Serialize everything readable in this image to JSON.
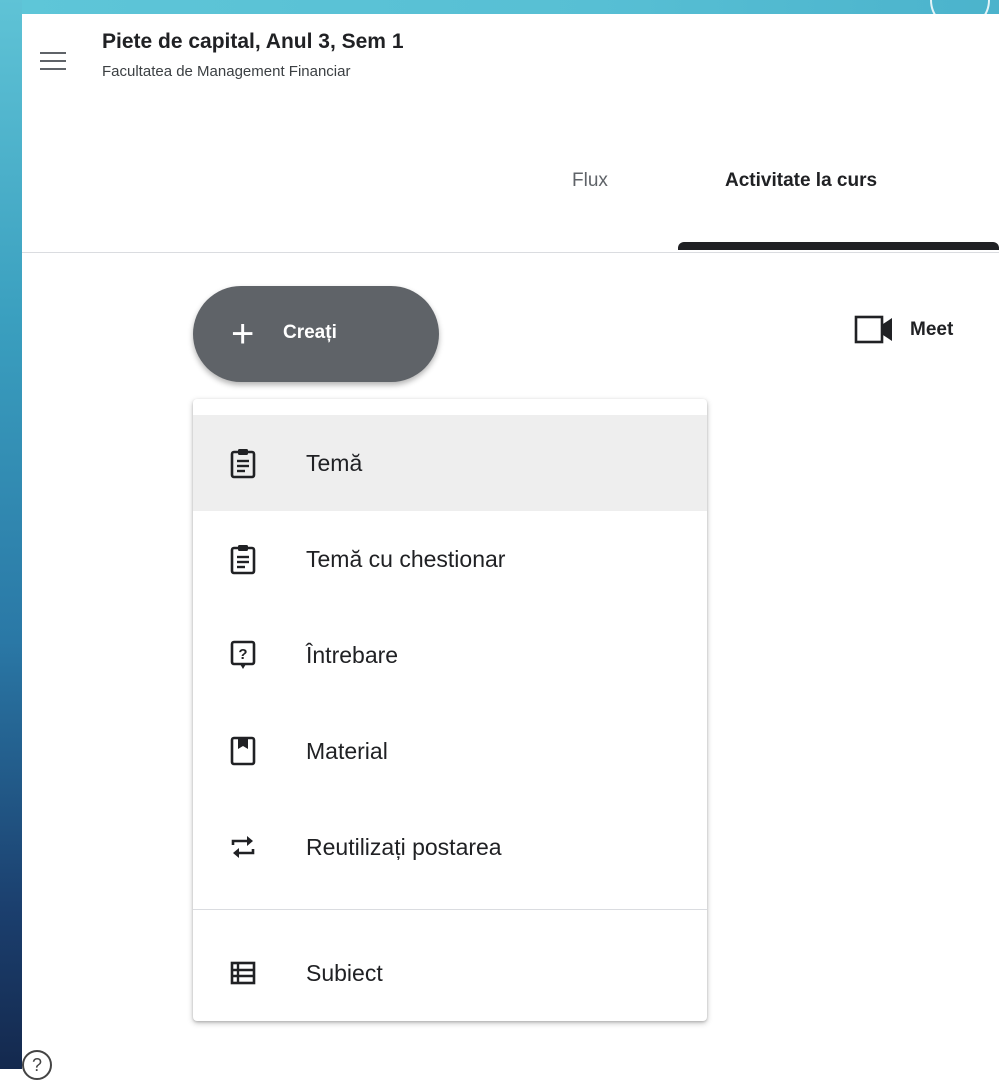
{
  "course": {
    "title": "Piete de capital, Anul 3, Sem 1",
    "subtitle": "Facultatea de Management Financiar"
  },
  "tabs": [
    {
      "label": "Flux",
      "selected": false
    },
    {
      "label": "Activitate la curs",
      "selected": true
    }
  ],
  "create_button": {
    "icon": "plus-icon",
    "label": "Creați"
  },
  "meet_button": {
    "icon": "video-camera-icon",
    "label": "Meet"
  },
  "create_menu": {
    "items": [
      {
        "label": "Temă",
        "icon": "assignment-icon",
        "highlighted": true
      },
      {
        "label": "Temă cu chestionar",
        "icon": "quiz-assignment-icon",
        "highlighted": false
      },
      {
        "label": "Întrebare",
        "icon": "question-icon",
        "highlighted": false
      },
      {
        "label": "Material",
        "icon": "material-icon",
        "highlighted": false
      },
      {
        "label": "Reutilizați postarea",
        "icon": "reuse-post-icon",
        "highlighted": false
      },
      {
        "label": "Subiect",
        "icon": "topic-icon",
        "highlighted": false
      }
    ]
  },
  "colors": {
    "dark_button": "#5f6368",
    "text_primary": "#202124",
    "highlight": "#eeeeee",
    "divider": "#dadce0"
  }
}
